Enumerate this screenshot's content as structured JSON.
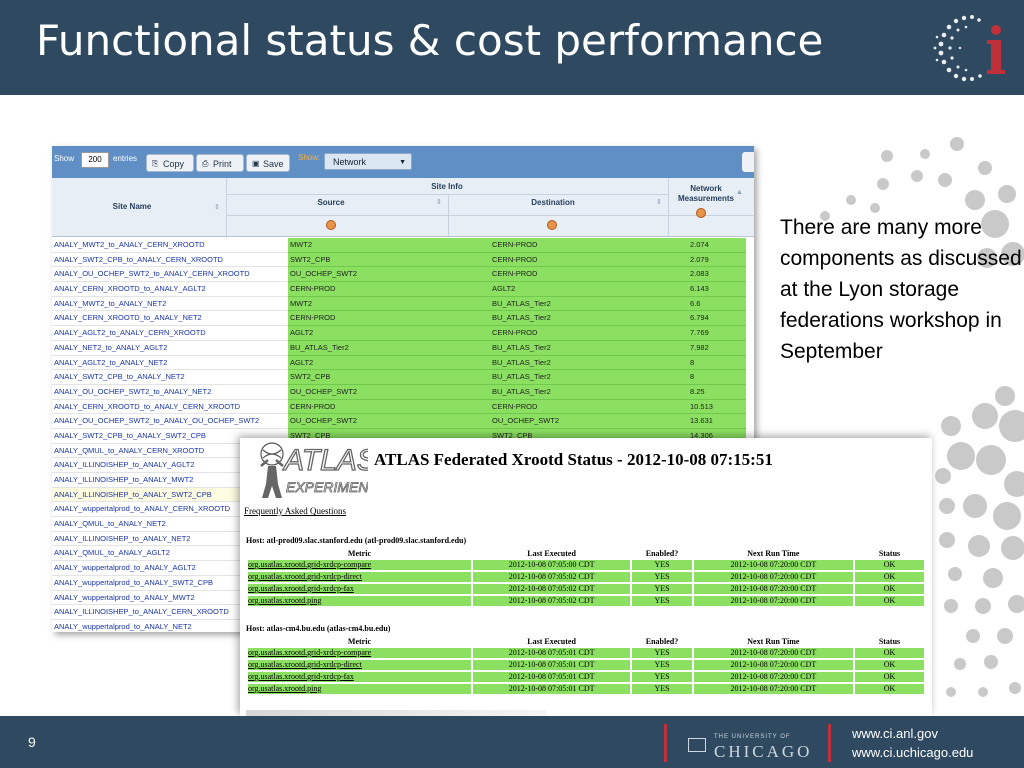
{
  "header": {
    "title": "Functional status & cost performance"
  },
  "side_text": "There are many more components as discussed at the Lyon storage federations workshop in September",
  "footer": {
    "page_number": "9",
    "uc_small": "THE UNIVERSITY OF",
    "uc_big": "CHICAGO",
    "url1": "www.ci.anl.gov",
    "url2": "www.ci.uchicago.edu"
  },
  "monitor": {
    "show_label": "Show",
    "entries_value": "200",
    "entries_label": "entries",
    "copy_label": "Copy",
    "print_label": "Print",
    "save_label": "Save",
    "dropdown_label": "Show:",
    "dropdown_value": "Network",
    "header_site_info": "Site Info",
    "col_site": "Site Name",
    "col_source": "Source",
    "col_destination": "Destination",
    "col_network": "Network",
    "col_measurements": "Measurements",
    "rows": [
      {
        "site": "ANALY_MWT2_to_ANALY_CERN_XROOTD",
        "src": "MWT2",
        "dst": "CERN-PROD",
        "val": "2.074"
      },
      {
        "site": "ANALY_SWT2_CPB_to_ANALY_CERN_XROOTD",
        "src": "SWT2_CPB",
        "dst": "CERN-PROD",
        "val": "2.079"
      },
      {
        "site": "ANALY_OU_OCHEP_SWT2_to_ANALY_CERN_XROOTD",
        "src": "OU_OCHEP_SWT2",
        "dst": "CERN-PROD",
        "val": "2.083"
      },
      {
        "site": "ANALY_CERN_XROOTD_to_ANALY_AGLT2",
        "src": "CERN-PROD",
        "dst": "AGLT2",
        "val": "6.143"
      },
      {
        "site": "ANALY_MWT2_to_ANALY_NET2",
        "src": "MWT2",
        "dst": "BU_ATLAS_Tier2",
        "val": "6.6"
      },
      {
        "site": "ANALY_CERN_XROOTD_to_ANALY_NET2",
        "src": "CERN-PROD",
        "dst": "BU_ATLAS_Tier2",
        "val": "6.794"
      },
      {
        "site": "ANALY_AGLT2_to_ANALY_CERN_XROOTD",
        "src": "AGLT2",
        "dst": "CERN-PROD",
        "val": "7.769"
      },
      {
        "site": "ANALY_NET2_to_ANALY_AGLT2",
        "src": "BU_ATLAS_Tier2",
        "dst": "BU_ATLAS_Tier2",
        "val": "7.982"
      },
      {
        "site": "ANALY_AGLT2_to_ANALY_NET2",
        "src": "AGLT2",
        "dst": "BU_ATLAS_Tier2",
        "val": "8"
      },
      {
        "site": "ANALY_SWT2_CPB_to_ANALY_NET2",
        "src": "SWT2_CPB",
        "dst": "BU_ATLAS_Tier2",
        "val": "8"
      },
      {
        "site": "ANALY_OU_OCHEP_SWT2_to_ANALY_NET2",
        "src": "OU_OCHEP_SWT2",
        "dst": "BU_ATLAS_Tier2",
        "val": "8.25"
      },
      {
        "site": "ANALY_CERN_XROOTD_to_ANALY_CERN_XROOTD",
        "src": "CERN-PROD",
        "dst": "CERN-PROD",
        "val": "10.513"
      },
      {
        "site": "ANALY_OU_OCHEP_SWT2_to_ANALY_OU_OCHEP_SWT2",
        "src": "OU_OCHEP_SWT2",
        "dst": "OU_OCHEP_SWT2",
        "val": "13.631"
      },
      {
        "site": "ANALY_SWT2_CPB_to_ANALY_SWT2_CPB",
        "src": "SWT2_CPB",
        "dst": "SWT2_CPB",
        "val": "14.306"
      },
      {
        "site": "ANALY_QMUL_to_ANALY_CERN_XROOTD",
        "src": "",
        "dst": "",
        "val": ""
      },
      {
        "site": "ANALY_ILLINOISHEP_to_ANALY_AGLT2",
        "src": "",
        "dst": "",
        "val": ""
      },
      {
        "site": "ANALY_ILLINOISHEP_to_ANALY_MWT2",
        "src": "",
        "dst": "",
        "val": ""
      },
      {
        "site": "ANALY_ILLINOISHEP_to_ANALY_SWT2_CPB",
        "src": "",
        "dst": "",
        "val": ""
      },
      {
        "site": "ANALY_wuppertalprod_to_ANALY_CERN_XROOTD",
        "src": "",
        "dst": "",
        "val": ""
      },
      {
        "site": "ANALY_QMUL_to_ANALY_NET2",
        "src": "",
        "dst": "",
        "val": ""
      },
      {
        "site": "ANALY_ILLINOISHEP_to_ANALY_NET2",
        "src": "",
        "dst": "",
        "val": ""
      },
      {
        "site": "ANALY_QMUL_to_ANALY_AGLT2",
        "src": "",
        "dst": "",
        "val": ""
      },
      {
        "site": "ANALY_wuppertalprod_to_ANALY_AGLT2",
        "src": "",
        "dst": "",
        "val": ""
      },
      {
        "site": "ANALY_wuppertalprod_to_ANALY_SWT2_CPB",
        "src": "",
        "dst": "",
        "val": ""
      },
      {
        "site": "ANALY_wuppertalprod_to_ANALY_MWT2",
        "src": "",
        "dst": "",
        "val": ""
      },
      {
        "site": "ANALY_ILLINOISHEP_to_ANALY_CERN_XROOTD",
        "src": "",
        "dst": "",
        "val": ""
      },
      {
        "site": "ANALY_wuppertalprod_to_ANALY_NET2",
        "src": "",
        "dst": "",
        "val": ""
      }
    ]
  },
  "xrootd": {
    "logo_text": "ATLAS",
    "logo_sub": "EXPERIMENT",
    "title": "ATLAS Federated Xrootd Status - 2012-10-08 07:15:51",
    "faq": "Frequently Asked Questions",
    "columns": [
      "Metric",
      "Last Executed",
      "Enabled?",
      "Next Run Time",
      "Status"
    ],
    "hosts": [
      {
        "label": "Host: atl-prod09.slac.stanford.edu (atl-prod09.slac.stanford.edu)",
        "rows": [
          [
            "org.usatlas.xrootd.grid-xrdcp-compare",
            "2012-10-08 07:05:00 CDT",
            "YES",
            "2012-10-08 07:20:00 CDT",
            "OK"
          ],
          [
            "org.usatlas.xrootd.grid-xrdcp-direct",
            "2012-10-08 07:05:02 CDT",
            "YES",
            "2012-10-08 07:20:00 CDT",
            "OK"
          ],
          [
            "org.usatlas.xrootd.grid-xrdcp-fax",
            "2012-10-08 07:05:02 CDT",
            "YES",
            "2012-10-08 07:20:00 CDT",
            "OK"
          ],
          [
            "org.usatlas.xrootd.ping",
            "2012-10-08 07:05:02 CDT",
            "YES",
            "2012-10-08 07:20:00 CDT",
            "OK"
          ]
        ]
      },
      {
        "label": "Host: atlas-cm4.bu.edu (atlas-cm4.bu.edu)",
        "rows": [
          [
            "org.usatlas.xrootd.grid-xrdcp-compare",
            "2012-10-08 07:05:01 CDT",
            "YES",
            "2012-10-08 07:20:00 CDT",
            "OK"
          ],
          [
            "org.usatlas.xrootd.grid-xrdcp-direct",
            "2012-10-08 07:05:01 CDT",
            "YES",
            "2012-10-08 07:20:00 CDT",
            "OK"
          ],
          [
            "org.usatlas.xrootd.grid-xrdcp-fax",
            "2012-10-08 07:05:01 CDT",
            "YES",
            "2012-10-08 07:20:00 CDT",
            "OK"
          ],
          [
            "org.usatlas.xrootd.ping",
            "2012-10-08 07:05:01 CDT",
            "YES",
            "2012-10-08 07:20:00 CDT",
            "OK"
          ]
        ]
      }
    ]
  },
  "colors": {
    "header_bg": "#2f4a60",
    "status_green": "#8be061",
    "accent_red": "#c0303b"
  }
}
